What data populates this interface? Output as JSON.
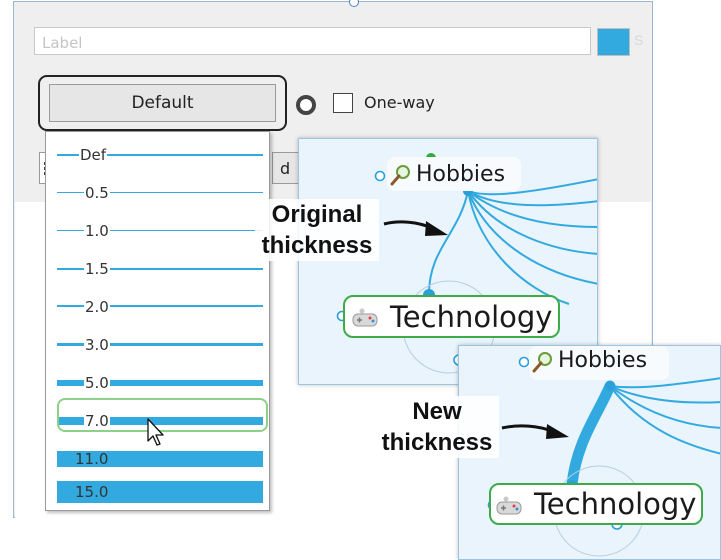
{
  "panel": {
    "label_placeholder": "Label",
    "accent_color": "#33aadf",
    "default_button_label": "Default",
    "oneway_label": "One-way",
    "oneway_checked": false,
    "partial_button_label": "d"
  },
  "dropdown": {
    "options": [
      {
        "label": "Def",
        "thickness": 2
      },
      {
        "label": "0.5",
        "thickness": 1
      },
      {
        "label": "1.0",
        "thickness": 1
      },
      {
        "label": "1.5",
        "thickness": 2
      },
      {
        "label": "2.0",
        "thickness": 2
      },
      {
        "label": "3.0",
        "thickness": 3
      },
      {
        "label": "5.0",
        "thickness": 5
      },
      {
        "label": "7.0",
        "thickness": 7
      },
      {
        "label": "11.0",
        "thickness": 11
      },
      {
        "label": "15.0",
        "thickness": 15
      }
    ],
    "hovered": "7.0"
  },
  "card_original": {
    "parent_topic": "Hobbies",
    "child_topic": "Technology",
    "annotation": "Original thickness",
    "annotation_lines": [
      "Original",
      "thickness"
    ]
  },
  "card_new": {
    "parent_topic": "Hobbies",
    "child_topic": "Technology",
    "annotation": "New thickness",
    "annotation_lines": [
      "New",
      "thickness"
    ]
  },
  "colors": {
    "link": "#33aadf",
    "focus_outline": "#222222",
    "topic_border": "#3eaa4a",
    "hover_border": "#8ed087"
  },
  "icons": [
    "magnifier-icon",
    "gamepad-icon",
    "grid-icon",
    "mouse-cursor-icon"
  ]
}
